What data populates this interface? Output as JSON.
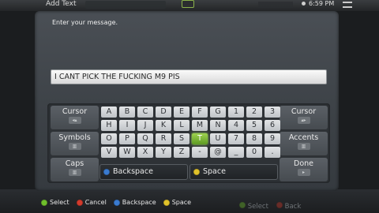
{
  "header": {
    "title": "Add Text",
    "clock": "6:59 PM"
  },
  "dialog": {
    "prompt": "Enter your message.",
    "message": "I CANT PICK THE FUCKING M9 PIS"
  },
  "keyboard": {
    "left_buttons": [
      {
        "label": "Cursor",
        "glyph": "◂▴"
      },
      {
        "label": "Symbols",
        "glyph": "▥"
      },
      {
        "label": "Caps",
        "glyph": "▥"
      }
    ],
    "right_buttons": [
      {
        "label": "Cursor",
        "glyph": "▴▸"
      },
      {
        "label": "Accents",
        "glyph": "▥"
      },
      {
        "label": "Done",
        "glyph": "▸"
      }
    ],
    "rows": [
      [
        "A",
        "B",
        "C",
        "D",
        "E",
        "F",
        "G",
        "1",
        "2",
        "3"
      ],
      [
        "H",
        "I",
        "J",
        "K",
        "L",
        "M",
        "N",
        "4",
        "5",
        "6"
      ],
      [
        "O",
        "P",
        "Q",
        "R",
        "S",
        "T",
        "U",
        "7",
        "8",
        "9"
      ],
      [
        "V",
        "W",
        "X",
        "Y",
        "Z",
        "-",
        "@",
        "_",
        "0",
        "."
      ]
    ],
    "selected_key": "T",
    "backspace_label": "Backspace",
    "space_label": "Space"
  },
  "legend": [
    {
      "button": "a",
      "label": "Select"
    },
    {
      "button": "b",
      "label": "Cancel"
    },
    {
      "button": "x",
      "label": "Backspace"
    },
    {
      "button": "y",
      "label": "Space"
    }
  ],
  "ghost_legend": [
    {
      "button": "a",
      "label": "Select"
    },
    {
      "button": "b",
      "label": "Back"
    }
  ],
  "colors": {
    "selected_key": "#7dbb36",
    "button_a": "#6fbf2c",
    "button_b": "#d23a2c",
    "button_x": "#3a7bd0",
    "button_y": "#e0c22b"
  }
}
